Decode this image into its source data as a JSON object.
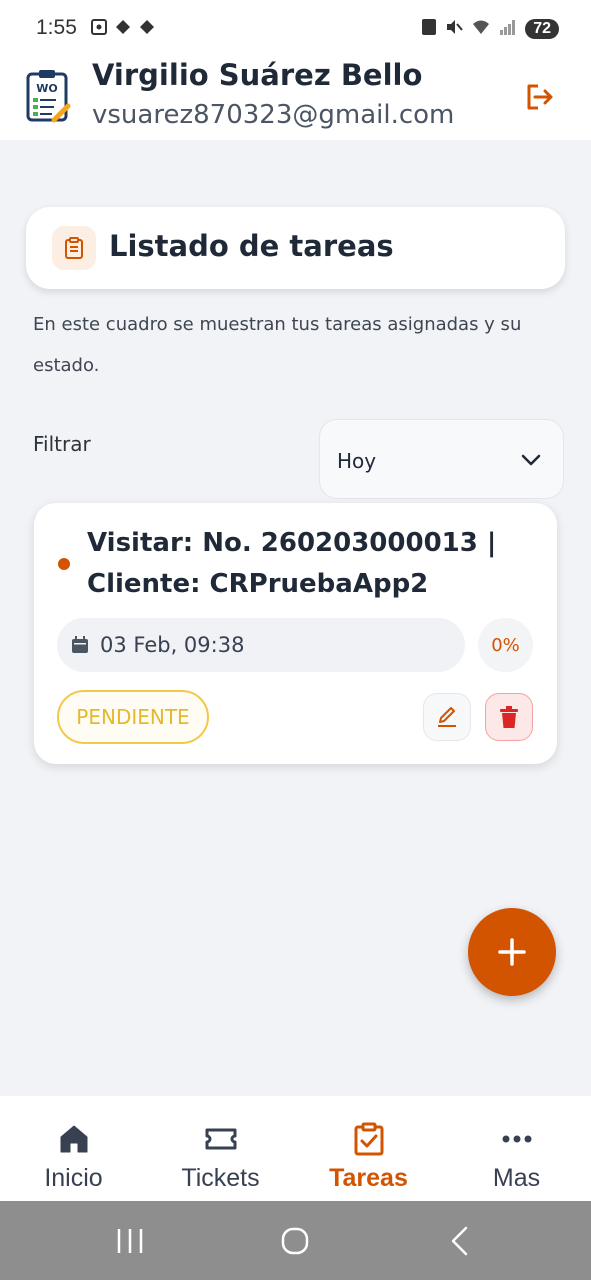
{
  "status_bar": {
    "time": "1:55",
    "battery": "72"
  },
  "header": {
    "user_name": "Virgilio Suárez Bello",
    "user_email": "vsuarez870323@gmail.com",
    "logo_text": "WO"
  },
  "page": {
    "title": "Listado de tareas",
    "description": "En este cuadro se muestran tus tareas asignadas y su estado."
  },
  "filter": {
    "label": "Filtrar",
    "selected": "Hoy"
  },
  "tasks": [
    {
      "title": "Visitar: No. 260203000013 | Cliente: CRPruebaApp2",
      "date": "03 Feb, 09:38",
      "progress": "0%",
      "status": "PENDIENTE"
    }
  ],
  "bottom_nav": {
    "items": [
      {
        "label": "Inicio",
        "icon": "home-icon"
      },
      {
        "label": "Tickets",
        "icon": "ticket-icon"
      },
      {
        "label": "Tareas",
        "icon": "clipboard-check-icon"
      },
      {
        "label": "Mas",
        "icon": "more-icon"
      }
    ],
    "active": "Tareas"
  },
  "colors": {
    "accent": "#d35400",
    "pending": "#e6b82e",
    "danger": "#dc2626"
  }
}
